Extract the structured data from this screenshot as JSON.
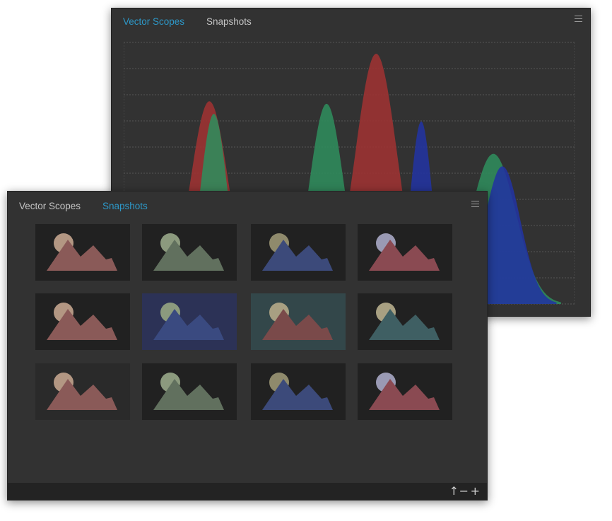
{
  "back_panel": {
    "tabs": [
      {
        "label": "Vector Scopes",
        "active": true
      },
      {
        "label": "Snapshots",
        "active": false
      }
    ],
    "menu_icon": "hamburger-menu-icon"
  },
  "front_panel": {
    "tabs": [
      {
        "label": "Vector Scopes",
        "active": false
      },
      {
        "label": "Snapshots",
        "active": true
      }
    ],
    "menu_icon": "hamburger-menu-icon",
    "thumbnails": [
      {
        "tint": "#8a5a58",
        "sun": "#b39783",
        "bg": "#212121"
      },
      {
        "tint": "#61705e",
        "sun": "#8c9a7e",
        "bg": "#212121"
      },
      {
        "tint": "#3c4a7a",
        "sun": "#8f8a6c",
        "bg": "#212121"
      },
      {
        "tint": "#8a4a52",
        "sun": "#9a9ab4",
        "bg": "#212121"
      },
      {
        "tint": "#8a5a58",
        "sun": "#b39783",
        "bg": "#212121"
      },
      {
        "tint": "#3a4a80",
        "sun": "#8c9a7e",
        "bg": "#2c3256"
      },
      {
        "tint": "#7a4a4a",
        "sun": "#a8a082",
        "bg": "#33474a"
      },
      {
        "tint": "#3f5f63",
        "sun": "#a8a082",
        "bg": "#212121"
      },
      {
        "tint": "#8a5a58",
        "sun": "#b39783",
        "bg": "#2a2a2a"
      },
      {
        "tint": "#61705e",
        "sun": "#8c9a7e",
        "bg": "#212121"
      },
      {
        "tint": "#3c4a7a",
        "sun": "#8f8a6c",
        "bg": "#212121"
      },
      {
        "tint": "#8a4a52",
        "sun": "#9a9ab4",
        "bg": "#212121"
      }
    ],
    "bottom_icons": [
      {
        "name": "export-arrow-icon",
        "glyph": "↑"
      },
      {
        "name": "minus-icon",
        "glyph": "−"
      },
      {
        "name": "plus-icon",
        "glyph": "+"
      }
    ]
  },
  "chart_data": {
    "type": "area",
    "xlim": [
      0,
      100
    ],
    "ylim": [
      0,
      10
    ],
    "grid": true,
    "gridlines": 11,
    "series": [
      {
        "color": "#9e3232",
        "peaks": [
          [
            19,
            8.1,
            4.2
          ],
          [
            56,
            10.0,
            4.6
          ]
        ]
      },
      {
        "color": "#2f8c5c",
        "peaks": [
          [
            20,
            7.6,
            3.0
          ],
          [
            45,
            8.0,
            3.8
          ],
          [
            82,
            6.0,
            5.0
          ]
        ]
      },
      {
        "color": "#2233a0",
        "peaks": [
          [
            66,
            7.3,
            2.4
          ],
          [
            84,
            5.5,
            4.0
          ]
        ]
      }
    ]
  }
}
